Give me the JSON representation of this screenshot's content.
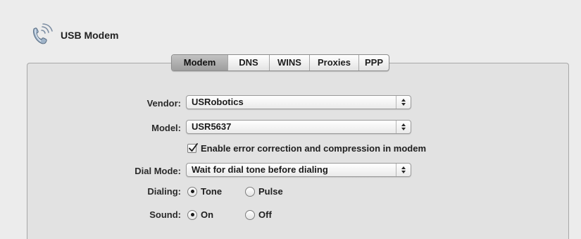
{
  "header": {
    "title": "USB Modem",
    "icon": "modem-phone-icon"
  },
  "tabs": [
    {
      "label": "Modem",
      "selected": true
    },
    {
      "label": "DNS",
      "selected": false
    },
    {
      "label": "WINS",
      "selected": false
    },
    {
      "label": "Proxies",
      "selected": false
    },
    {
      "label": "PPP",
      "selected": false
    }
  ],
  "form": {
    "vendor": {
      "label": "Vendor:",
      "value": "USRobotics"
    },
    "model": {
      "label": "Model:",
      "value": "USR5637"
    },
    "error_correction": {
      "label": "Enable error correction and compression in modem",
      "checked": true
    },
    "dial_mode": {
      "label": "Dial Mode:",
      "value": "Wait for dial tone before dialing"
    },
    "dialing": {
      "label": "Dialing:",
      "options": [
        {
          "label": "Tone",
          "selected": true
        },
        {
          "label": "Pulse",
          "selected": false
        }
      ]
    },
    "sound": {
      "label": "Sound:",
      "options": [
        {
          "label": "On",
          "selected": true
        },
        {
          "label": "Off",
          "selected": false
        }
      ]
    }
  },
  "colors": {
    "window_bg": "#ececec",
    "pane_bg": "#e2e2e2",
    "selected_tab": "#a8a8a8"
  }
}
